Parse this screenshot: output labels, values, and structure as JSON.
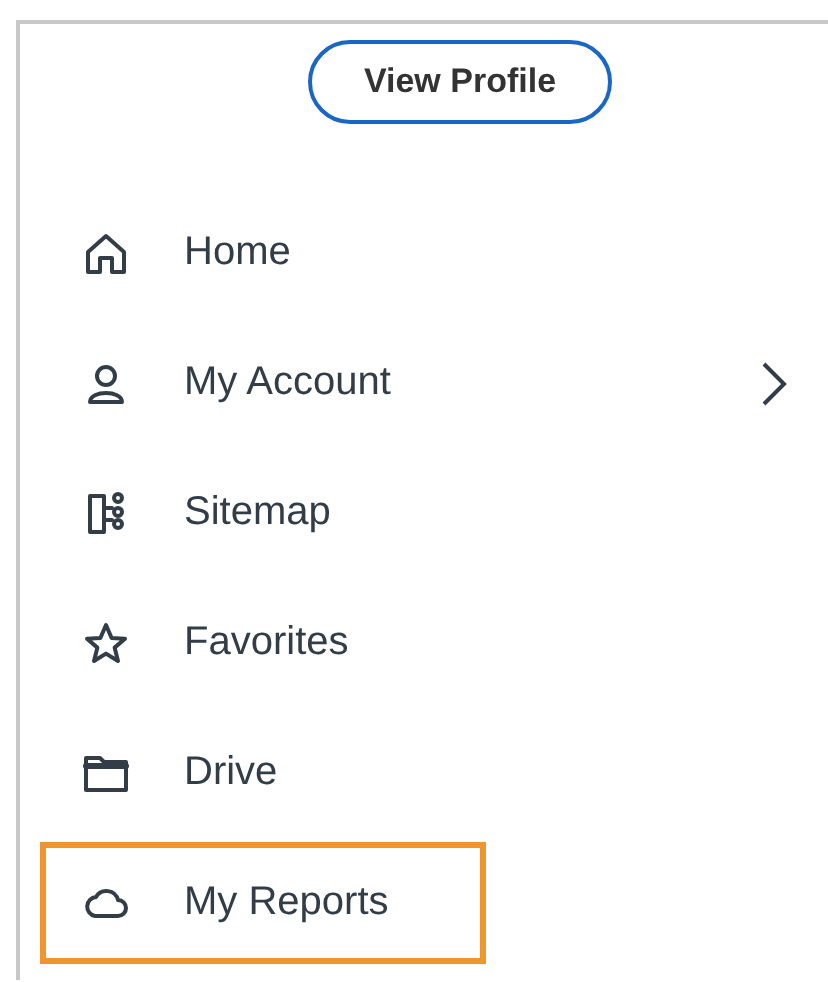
{
  "profile_button": "View Profile",
  "menu": [
    {
      "label": "Home",
      "kind": "home",
      "has_submenu": false,
      "highlighted": false
    },
    {
      "label": "My Account",
      "kind": "person",
      "has_submenu": true,
      "highlighted": false
    },
    {
      "label": "Sitemap",
      "kind": "sitemap",
      "has_submenu": false,
      "highlighted": false
    },
    {
      "label": "Favorites",
      "kind": "star",
      "has_submenu": false,
      "highlighted": false
    },
    {
      "label": "Drive",
      "kind": "folder",
      "has_submenu": false,
      "highlighted": false
    },
    {
      "label": "My Reports",
      "kind": "cloud",
      "has_submenu": false,
      "highlighted": true
    }
  ]
}
